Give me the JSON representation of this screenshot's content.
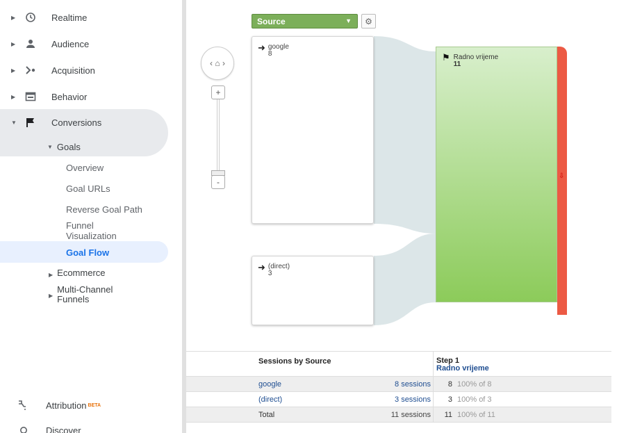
{
  "sidebar": {
    "items": [
      {
        "label": "Realtime"
      },
      {
        "label": "Audience"
      },
      {
        "label": "Acquisition"
      },
      {
        "label": "Behavior"
      },
      {
        "label": "Conversions"
      }
    ],
    "goals_label": "Goals",
    "goal_items": [
      {
        "label": "Overview"
      },
      {
        "label": "Goal URLs"
      },
      {
        "label": "Reverse Goal Path"
      },
      {
        "label": "Funnel\nVisualization"
      },
      {
        "label": "Goal Flow"
      }
    ],
    "ecommerce_label": "Ecommerce",
    "multichannel_label": "Multi-Channel\nFunnels",
    "attribution_label": "Attribution",
    "attribution_badge": "BETA",
    "discover_label": "Discover"
  },
  "flow": {
    "dimension_select": "Source",
    "nodes": [
      {
        "label": "google",
        "value": "8"
      },
      {
        "label": "(direct)",
        "value": "3"
      }
    ],
    "goal": {
      "label": "Radno vrijeme",
      "value": "11"
    }
  },
  "table": {
    "col1_header": "Sessions by Source",
    "step_header": "Step 1",
    "step_goal": "Radno vrijeme",
    "rows": [
      {
        "name": "google",
        "sessions": "8 sessions",
        "value": "8",
        "pct": "100% of 8"
      },
      {
        "name": "(direct)",
        "sessions": "3 sessions",
        "value": "3",
        "pct": "100% of 3"
      },
      {
        "name": "Total",
        "sessions": "11 sessions",
        "value": "11",
        "pct": "100% of 11"
      }
    ]
  },
  "colors": {
    "source_select": "#7caf5a",
    "goal_green": "#8ccb5a",
    "dropoff_red": "#ec5a44",
    "link_blue": "#1f4e91",
    "active_blue": "#1a73e8"
  }
}
